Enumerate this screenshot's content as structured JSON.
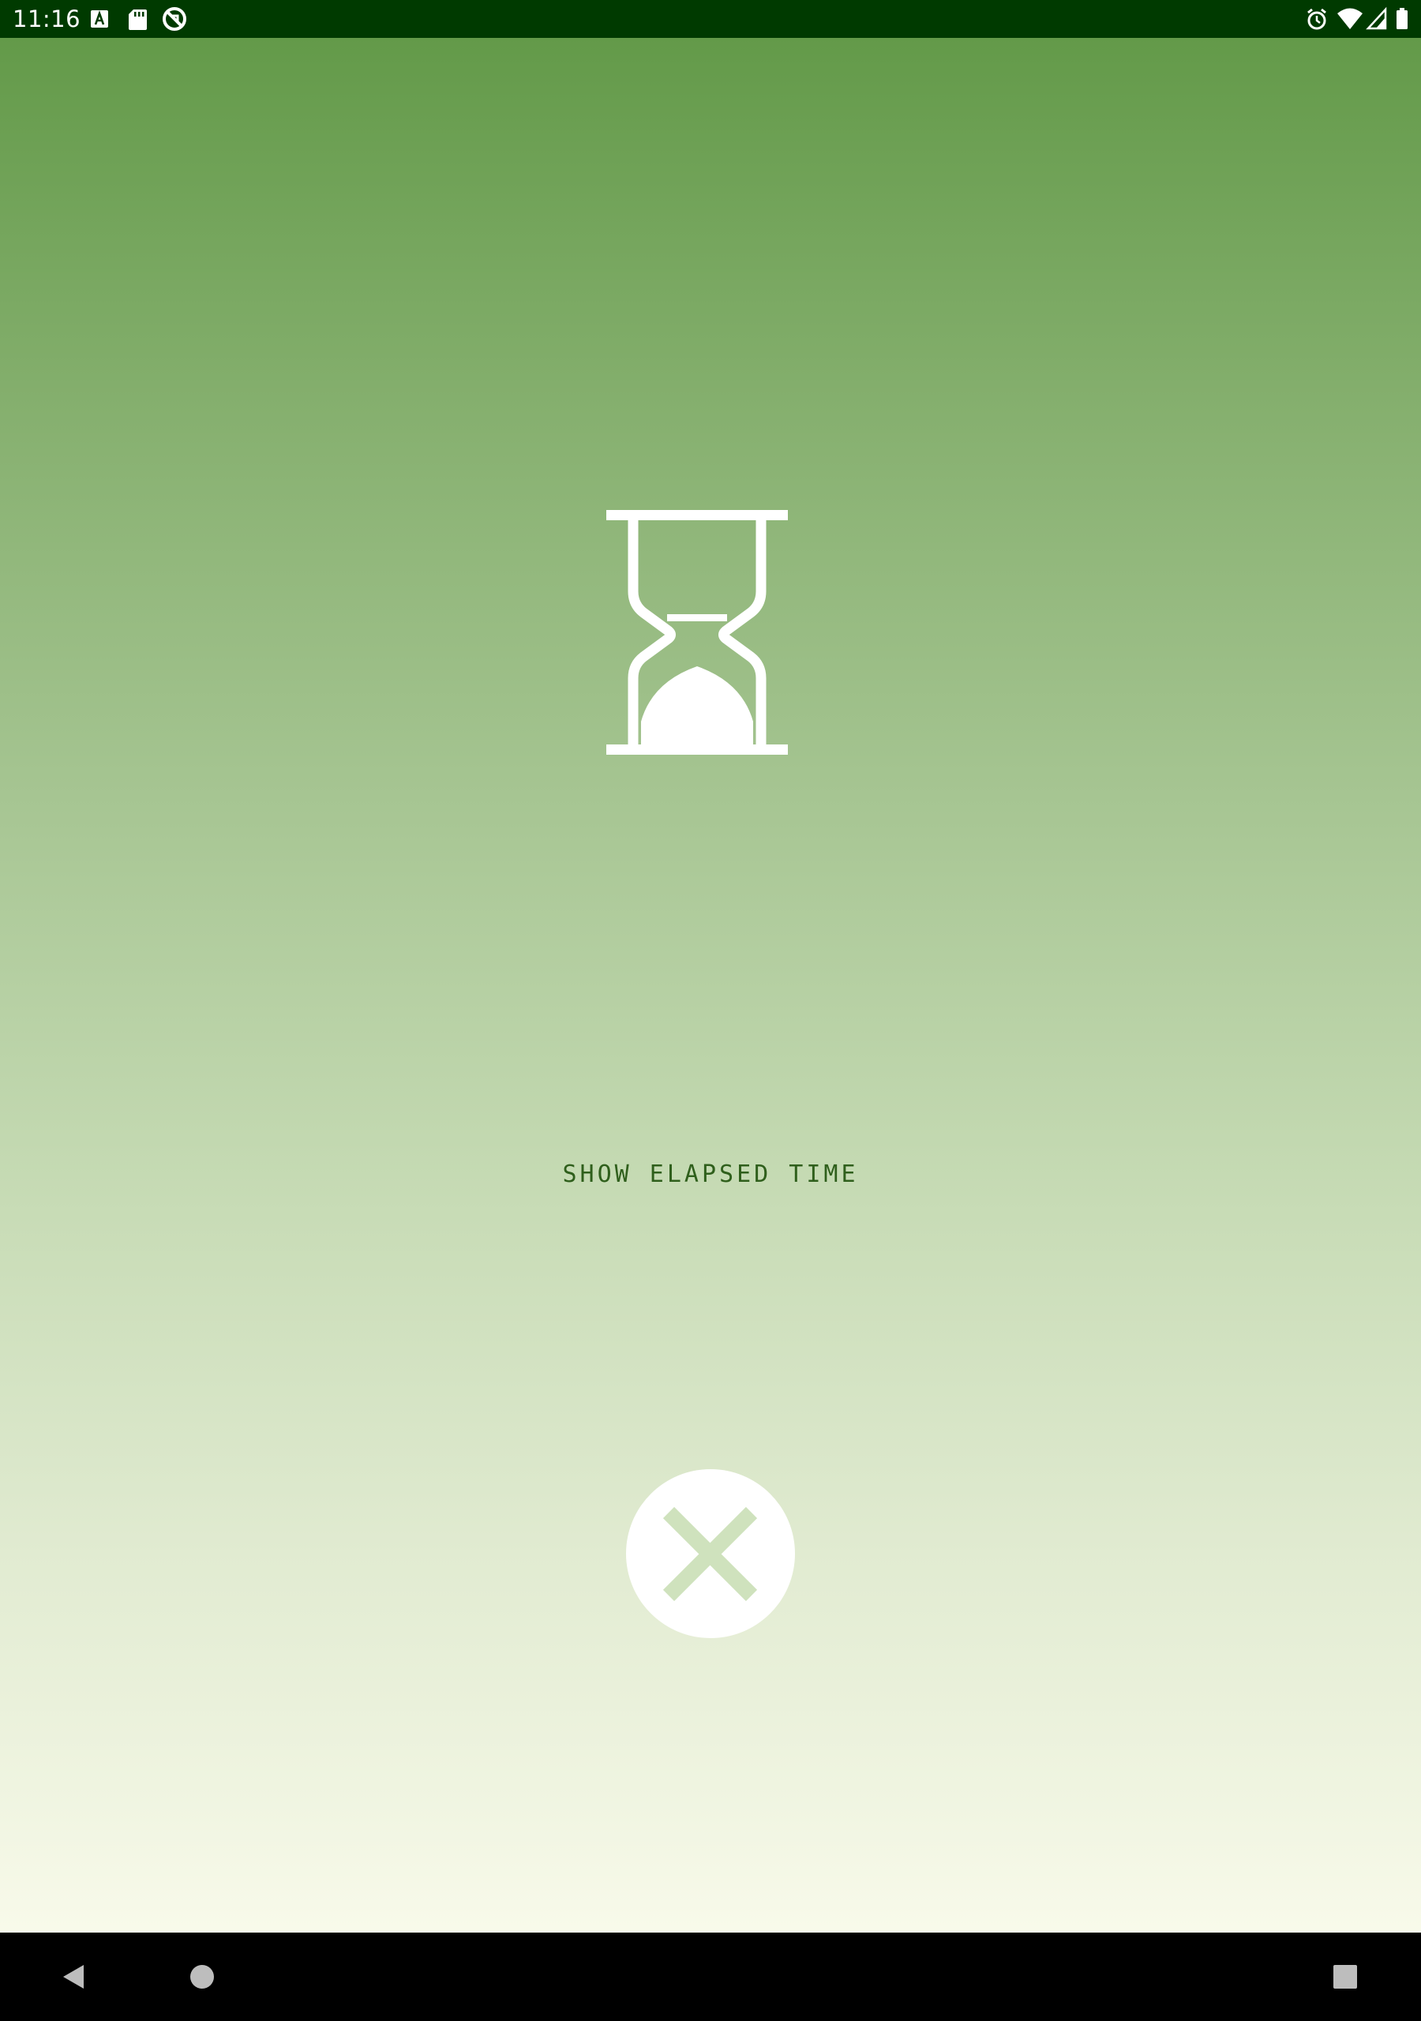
{
  "status_bar": {
    "time": "11:16",
    "left_icons": [
      "font-a-icon",
      "sd-card-icon",
      "sync-blocked-icon"
    ],
    "right_icons": [
      "alarm-icon",
      "wifi-icon",
      "cell-signal-icon",
      "battery-icon"
    ],
    "background": "#003a00"
  },
  "main": {
    "icon": "hourglass-icon",
    "elapsed_label": "SHOW ELAPSED TIME",
    "close_icon": "close-icon",
    "gradient_top": "#639a49",
    "gradient_bottom": "#f8faea",
    "label_color": "#2f5f1c"
  },
  "nav_bar": {
    "buttons": [
      "back-icon",
      "home-icon",
      "recents-icon"
    ]
  }
}
